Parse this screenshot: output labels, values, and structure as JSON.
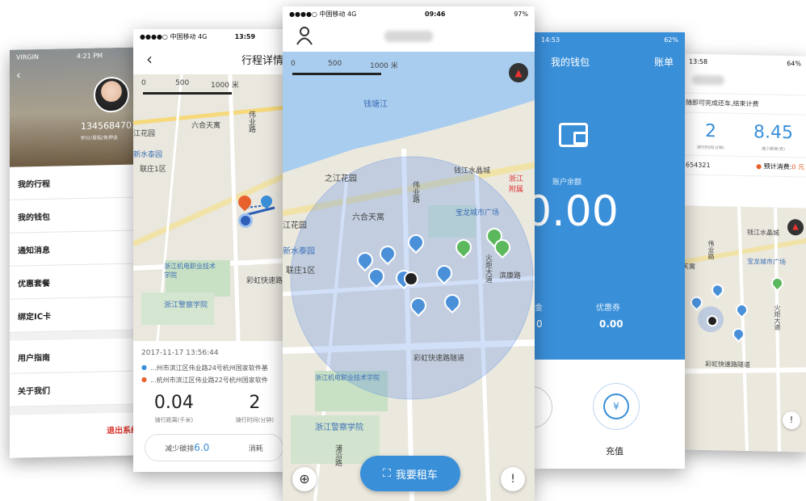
{
  "phone1": {
    "status": {
      "carrier": "VIRGIN",
      "time": "4:21 PM"
    },
    "phone_number": "13456847018",
    "sub_text": "积分/里程/免押金",
    "menu": [
      "我的行程",
      "我的钱包",
      "通知消息",
      "优惠套餐",
      "绑定IC卡",
      "用户指南",
      "关于我们"
    ],
    "logout": "退出系统"
  },
  "phone2": {
    "status": {
      "carrier": "●●●●○ 中国移动 4G",
      "time": "13:59"
    },
    "title": "行程详情",
    "scale": [
      "0",
      "500",
      "1000 米"
    ],
    "map_labels": [
      "六合天寓",
      "伟业路",
      "江花园",
      "新水泰园",
      "联庄1区",
      "浙江机电职业技术学院",
      "彩虹快速路",
      "浙江警察学院",
      "南"
    ],
    "datetime": "2017-11-17 13:56:44",
    "route_from": "...州市滨江区伟业路24号杭州国家软件基",
    "route_to": "...杭州市滨江区伟业路22号杭州国家软件",
    "stats": [
      {
        "value": "0.04",
        "label": "骑行距离(千米)"
      },
      {
        "value": "2",
        "label": "骑行时间(分钟)"
      }
    ],
    "carbon_label": "减少碳排",
    "carbon_value": "6.0",
    "consume_label": "消耗"
  },
  "phone3": {
    "status": {
      "carrier": "●●●●○ 中国移动 4G",
      "time": "09:46",
      "battery": "97%"
    },
    "scale": [
      "0",
      "500",
      "1000 米"
    ],
    "map_labels": [
      "钱塘江",
      "之江花园",
      "伟业路",
      "六合天寓",
      "钱江水晶城",
      "宝龙城市广场",
      "江花园",
      "新水泰园",
      "联庄1区",
      "火炬大道",
      "滨康路",
      "浙江机电职业技术学院",
      "彩虹快速路隧道",
      "浙江警察学院",
      "浦沿路",
      "浙江附属"
    ],
    "rent_button": "我要租车"
  },
  "phone4": {
    "status": {
      "time": "14:53",
      "battery": "62%"
    },
    "title": "我的钱包",
    "bill": "账单",
    "balance_label": "账户余额",
    "balance": "0.00",
    "left_label": "金",
    "left_value": "0",
    "coupon_label": "优惠券",
    "coupon_value": "0.00",
    "recharge": "充值"
  },
  "phone5": {
    "status": {
      "time": "13:58",
      "battery": "64%"
    },
    "notice": "随即可完成还车,结束计费",
    "stats": [
      {
        "value": "2",
        "label": "骑行时间(分钟)"
      },
      {
        "value": "8.45",
        "label": "减少碳排(克)"
      }
    ],
    "bike_id": "654321",
    "estimate_label": "预计消费:",
    "estimate_value": "0 元",
    "map_labels": [
      "钱江水晶城",
      "伟业路",
      "宝龙城市广场",
      "天寓",
      "火炬大道",
      "彩虹快速路隧道"
    ]
  },
  "colors": {
    "primary": "#3a8fd9",
    "bike_blue": "#4a90d9",
    "bike_green": "#5cb85c",
    "logout_red": "#d9342b",
    "map_water": "#a9cdef"
  }
}
